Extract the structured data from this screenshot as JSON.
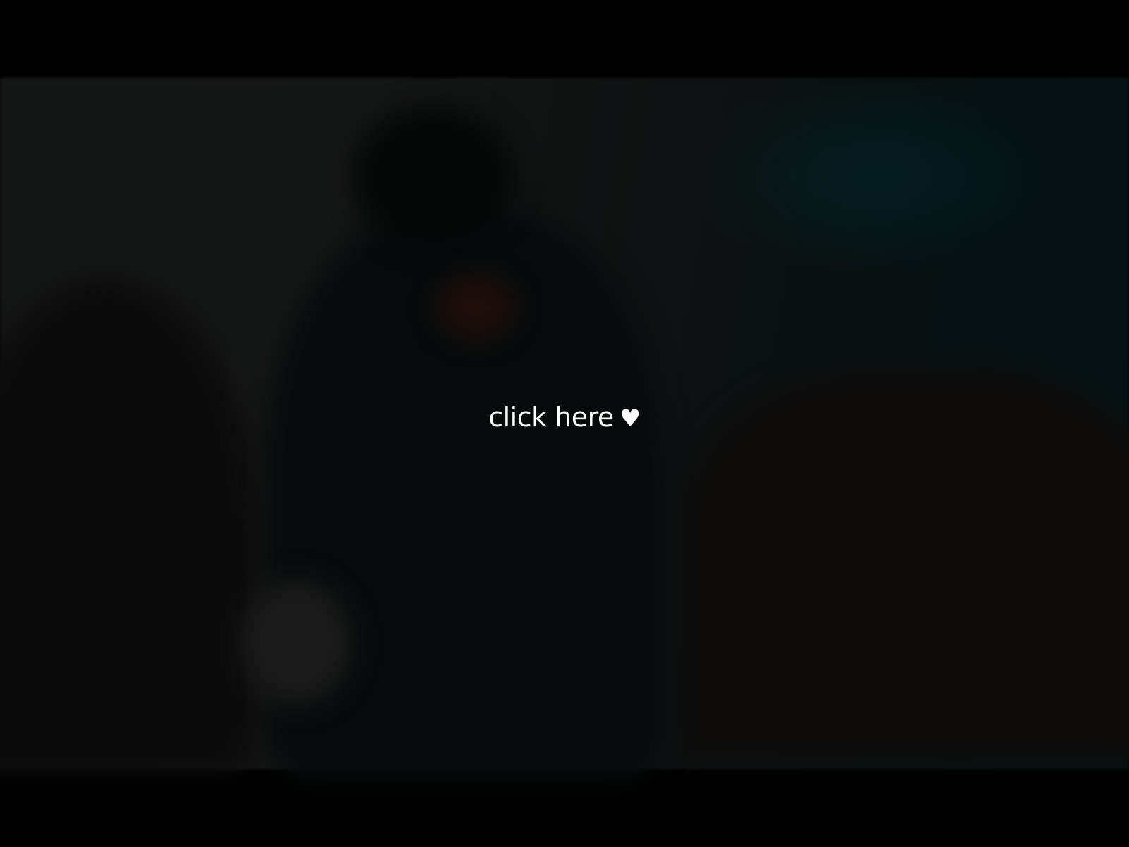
{
  "overlay": {
    "link_text": "click here",
    "icon_glyph": "♥",
    "icon": "heart-icon",
    "text_color": "#ffffff"
  },
  "background": {
    "letterbox_color": "#000000"
  }
}
